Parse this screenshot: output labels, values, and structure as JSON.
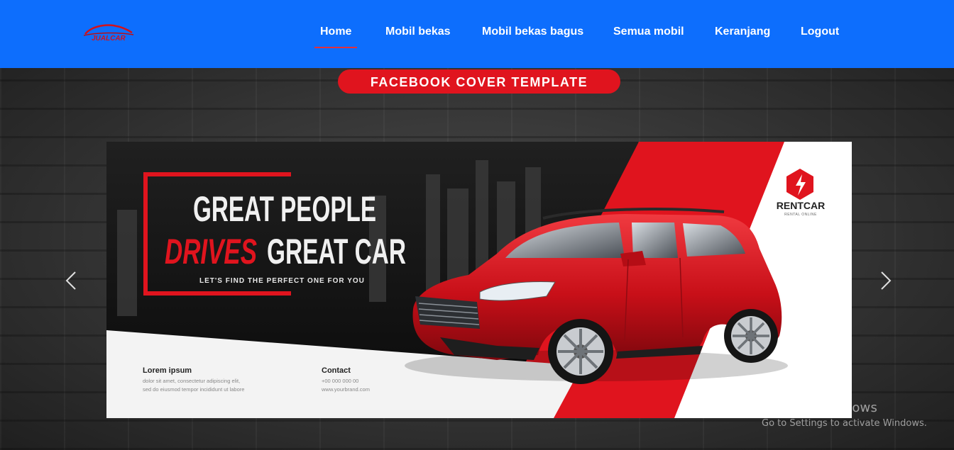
{
  "brand": {
    "logo_text": "JUALCAR"
  },
  "nav": {
    "items": [
      {
        "label": "Home",
        "active": true
      },
      {
        "label": "Mobil bekas",
        "active": false
      },
      {
        "label": "Mobil bekas bagus",
        "active": false
      },
      {
        "label": "Semua mobil",
        "active": false
      },
      {
        "label": "Keranjang",
        "active": false
      },
      {
        "label": "Logout",
        "active": false
      }
    ]
  },
  "carousel": {
    "prev_icon": "chevron-left-icon",
    "next_icon": "chevron-right-icon",
    "slide": {
      "badge": "FACEBOOK COVER TEMPLATE",
      "headline_line1": "GREAT PEOPLE",
      "headline_highlight": "DRIVES",
      "headline_rest": "GREAT CAR",
      "tagline": "LET'S FIND THE PERFECT ONE FOR YOU",
      "brand_name": "RENTCAR",
      "brand_sub": "RENTAL ONLINE",
      "info_title": "Lorem ipsum",
      "info_line1": "dolor sit amet, consectetur adipiscing elit,",
      "info_line2": "sed do eiusmod tempor incididunt ut labore",
      "contact_title": "Contact",
      "contact_phone": "+00 000 000 00",
      "contact_web": "www.yourbrand.com"
    }
  },
  "watermark": {
    "title": "Activate Windows",
    "subtitle": "Go to Settings to activate Windows."
  },
  "colors": {
    "navbar": "#0d6efd",
    "active_underline": "#e3303a",
    "accent_red": "#e0141e",
    "car_red": "#d3121b"
  }
}
